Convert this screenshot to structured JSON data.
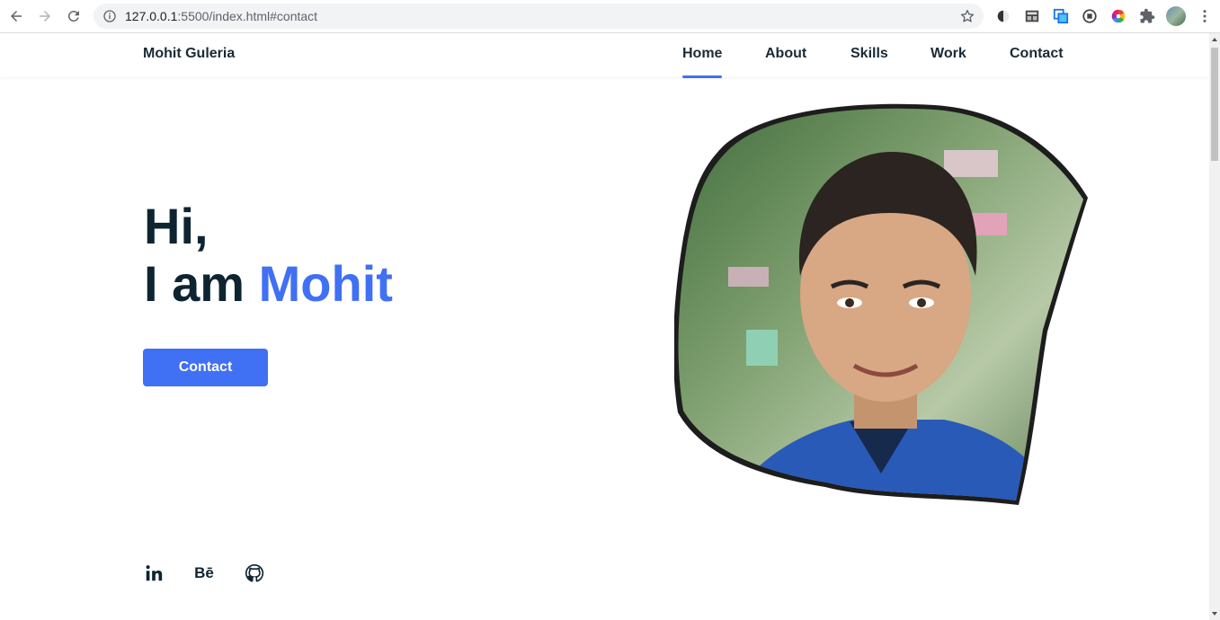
{
  "browser": {
    "url_host": "127.0.0.1",
    "url_path": ":5500/index.html#contact",
    "icons": [
      "back-icon",
      "forward-icon",
      "reload-icon",
      "info-icon",
      "star-icon",
      "dark-reader-icon",
      "guest-mode-icon",
      "window-resizer-icon",
      "record-icon",
      "color-picker-icon",
      "extensions-icon",
      "profile-avatar",
      "more-menu-icon"
    ]
  },
  "header": {
    "logo": "Mohit Guleria",
    "menu": [
      "Home",
      "About",
      "Skills",
      "Work",
      "Contact"
    ],
    "active_menu": "Home"
  },
  "hero": {
    "line1": "Hi,",
    "line2_prefix": "I am ",
    "line2_name": "Mohit",
    "button": "Contact"
  },
  "social": {
    "behance": "Bē",
    "icons": [
      "linkedin-icon",
      "behance-icon",
      "github-icon"
    ]
  },
  "colors": {
    "accent": "#4070f4",
    "text_dark": "#0e2431"
  }
}
